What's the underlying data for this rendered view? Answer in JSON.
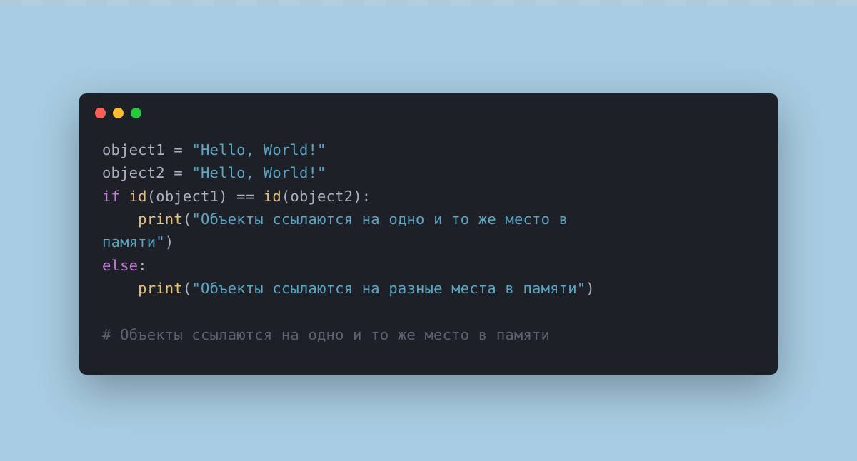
{
  "window": {
    "traffic_lights": {
      "red": "#ff5f56",
      "yellow": "#ffbd2e",
      "green": "#27c93f"
    }
  },
  "code": {
    "line1": {
      "var": "object1",
      "assign": " = ",
      "str": "\"Hello, World!\""
    },
    "line2": {
      "var": "object2",
      "assign": " = ",
      "str": "\"Hello, World!\""
    },
    "line3": {
      "kw_if": "if",
      "sp1": " ",
      "fn1": "id",
      "paren1": "(object1) ",
      "op": "==",
      "sp2": " ",
      "fn2": "id",
      "paren2": "(object2):"
    },
    "line4": {
      "indent": "    ",
      "fn": "print",
      "paren_open": "(",
      "str": "\"Объекты ссылаются на одно и то же место в "
    },
    "line5": {
      "str": "памяти\"",
      "paren_close": ")"
    },
    "line6": {
      "kw_else": "else",
      "colon": ":"
    },
    "line7": {
      "indent": "    ",
      "fn": "print",
      "paren_open": "(",
      "str": "\"Объекты ссылаются на разные места в памяти\"",
      "paren_close": ")"
    },
    "line9": {
      "comment": "# Объекты ссылаются на одно и то же место в памяти"
    }
  }
}
